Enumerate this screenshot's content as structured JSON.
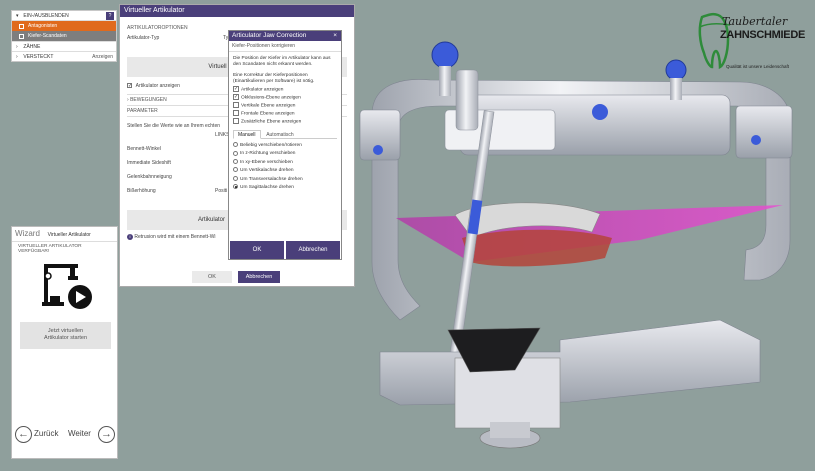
{
  "tree": {
    "head_label": "EIN-/AUSBLENDEN",
    "help_label": "?",
    "items": [
      {
        "label": "Antagonisten",
        "style": "orange"
      },
      {
        "label": "Kiefer-Scandaten",
        "style": "grey"
      }
    ],
    "rows": [
      {
        "label": "ZÄHNE",
        "right": ""
      },
      {
        "label": "VERSTECKT",
        "right": "Anzeigen"
      }
    ]
  },
  "virtual_articulator": {
    "title": "Virtueller Artikulator",
    "options_header": "ARTIKULATOROPTIONEN",
    "type_label": "Artikulator-Typ",
    "type_value": "Typ",
    "insert_button": "Virtuell einartikulieren",
    "show_checkbox": "Artikulator anzeigen",
    "movements_header": "BEWEGUNGEN",
    "parameters_header": "PARAMETER",
    "parameters_text": "Stellen Sie die Werte wie an Ihrem echten",
    "left_label": "LINKS",
    "params": [
      "Bennett-Winkel",
      "Immediate Sideshift",
      "Gelenkbahnneigung",
      "Bißerhöhung"
    ],
    "position_label": "Positi",
    "articulator_button": "Artikulator",
    "info_text": "Retrusion wird mit einem Bennett-Wi",
    "ok_label": "OK",
    "cancel_label": "Abbrechen"
  },
  "jaw_correction": {
    "title": "Articulator Jaw Correction",
    "close_label": "×",
    "subtitle": "Kiefer-Positionen korrigieren",
    "paragraph1": "Die Position der Kiefer im Artikulator kann aus den Scandaten nicht erkannt werden.",
    "paragraph2": "Eine Korrektur der Kieferpositionen (Einartikulieren per Software) ist nötig.",
    "checkboxes": [
      {
        "label": "Artikulator anzeigen",
        "checked": true
      },
      {
        "label": "Okklusions-Ebene anzeigen",
        "checked": true
      },
      {
        "label": "Vertikale Ebene anzeigen",
        "checked": false
      },
      {
        "label": "Frontale Ebene anzeigen",
        "checked": false
      },
      {
        "label": "Zusätzliche Ebene anzeigen",
        "checked": false
      }
    ],
    "tabs": [
      {
        "label": "Manuell",
        "active": true
      },
      {
        "label": "Automatisch",
        "active": false
      }
    ],
    "radios": [
      {
        "label": "Beliebig verschieben/rotieren",
        "selected": false
      },
      {
        "label": "In z-Richtung verschieben",
        "selected": false
      },
      {
        "label": "In xy-Ebene verschieben",
        "selected": false
      },
      {
        "label": "Um Vertikalachse drehen",
        "selected": false
      },
      {
        "label": "Um Transversalachse drehen",
        "selected": false
      },
      {
        "label": "Um Sagittalachse drehen",
        "selected": true
      }
    ],
    "ok_label": "OK",
    "cancel_label": "Abbrechen"
  },
  "wizard": {
    "title": "Wizard",
    "subtitle": "Virtueller Artikulator",
    "status": "VIRTUELLER ARTIKULATOR VERFÜGBAR!",
    "start_button": [
      "Jetzt virtuellen",
      "Artikulator starten"
    ],
    "back_label": "Zurück",
    "next_label": "Weiter"
  },
  "logo": {
    "line1": "Taubertaler",
    "line2": "ZAHNSCHMIEDE",
    "tagline": "Qualität ist unsere Leidenschaft"
  },
  "colors": {
    "background": "#8f9f9c",
    "title_bar": "#4a3f7a",
    "accent_orange": "#e06a1d",
    "logo_green": "#2e8b3a"
  }
}
